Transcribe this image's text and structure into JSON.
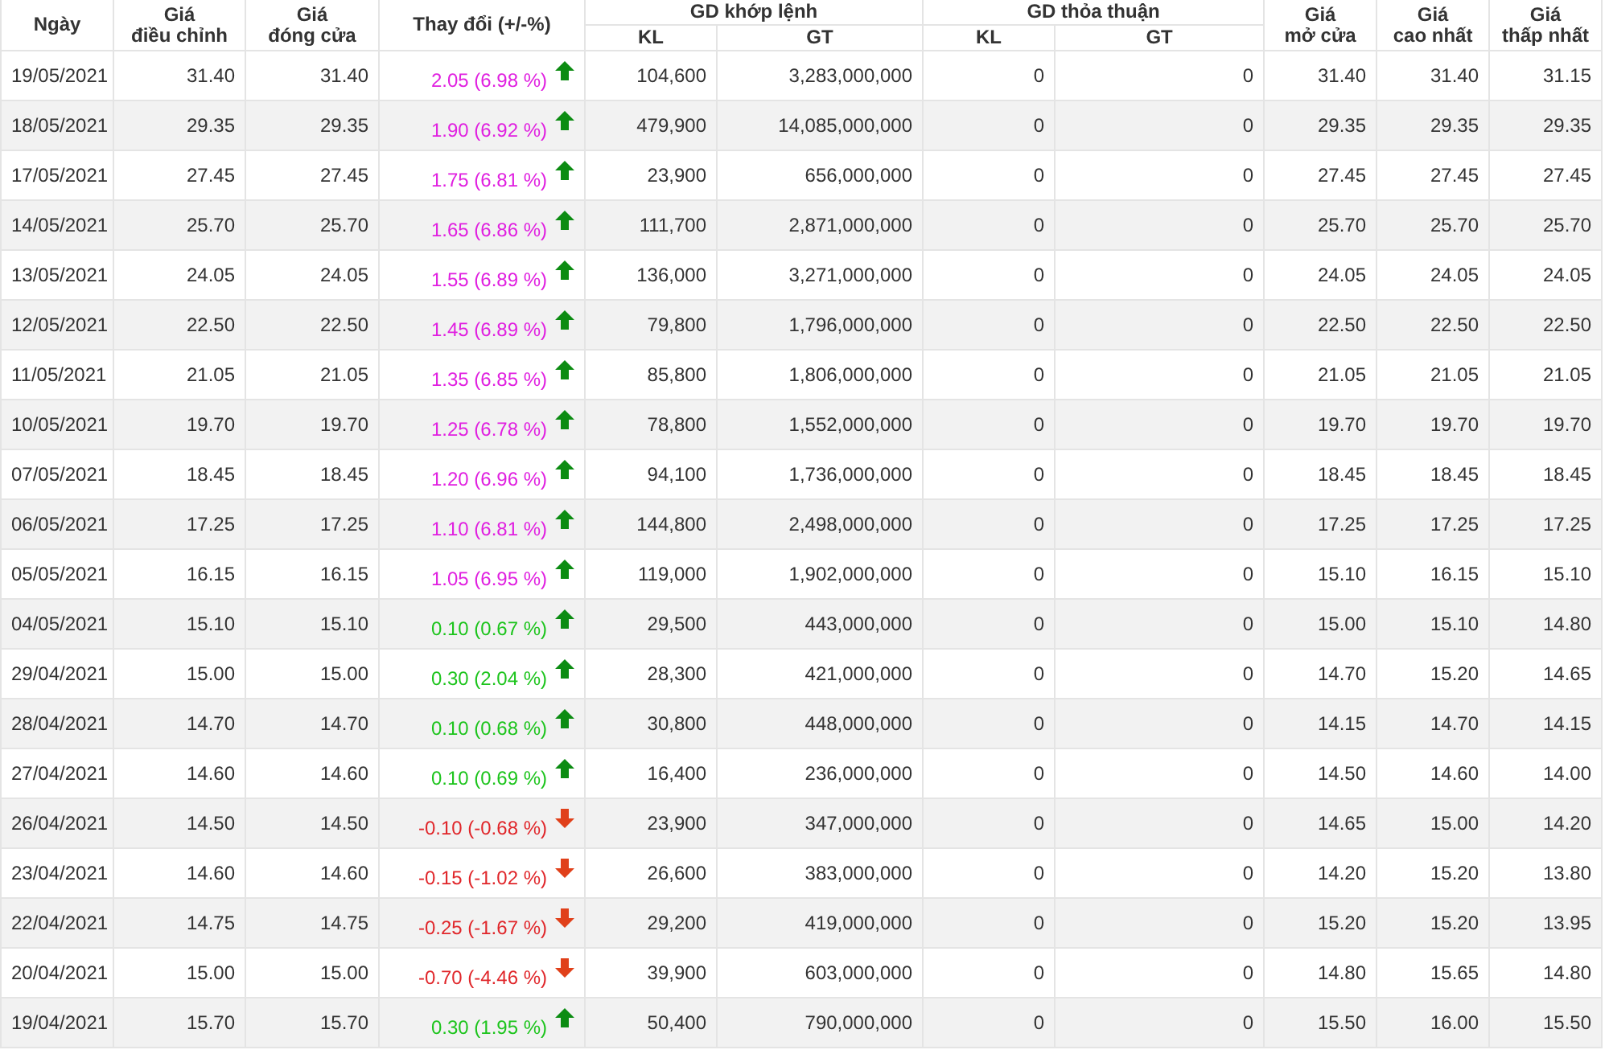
{
  "table": {
    "columns": [
      {
        "label": "Ngày"
      },
      {
        "label": "Giá\nđiều chỉnh"
      },
      {
        "label": "Giá\nđóng cửa"
      },
      {
        "label": "Thay đổi (+/-%)"
      },
      {
        "label": "GD khớp lệnh",
        "children": [
          "KL",
          "GT"
        ]
      },
      {
        "label": "GD thỏa thuận",
        "children": [
          "KL",
          "GT"
        ]
      },
      {
        "label": "Giá\nmở cửa"
      },
      {
        "label": "Giá\ncao nhất"
      },
      {
        "label": "Giá\nthấp nhất"
      }
    ],
    "rows": [
      {
        "date": "19/05/2021",
        "adjusted": "31.40",
        "close": "31.40",
        "change": "2.05 (6.98 %)",
        "kind": "ceiling",
        "matched_kl": "104,600",
        "matched_gt": "3,283,000,000",
        "deal_kl": "0",
        "deal_gt": "0",
        "open": "31.40",
        "high": "31.40",
        "low": "31.15"
      },
      {
        "date": "18/05/2021",
        "adjusted": "29.35",
        "close": "29.35",
        "change": "1.90 (6.92 %)",
        "kind": "ceiling",
        "matched_kl": "479,900",
        "matched_gt": "14,085,000,000",
        "deal_kl": "0",
        "deal_gt": "0",
        "open": "29.35",
        "high": "29.35",
        "low": "29.35"
      },
      {
        "date": "17/05/2021",
        "adjusted": "27.45",
        "close": "27.45",
        "change": "1.75 (6.81 %)",
        "kind": "ceiling",
        "matched_kl": "23,900",
        "matched_gt": "656,000,000",
        "deal_kl": "0",
        "deal_gt": "0",
        "open": "27.45",
        "high": "27.45",
        "low": "27.45"
      },
      {
        "date": "14/05/2021",
        "adjusted": "25.70",
        "close": "25.70",
        "change": "1.65 (6.86 %)",
        "kind": "ceiling",
        "matched_kl": "111,700",
        "matched_gt": "2,871,000,000",
        "deal_kl": "0",
        "deal_gt": "0",
        "open": "25.70",
        "high": "25.70",
        "low": "25.70"
      },
      {
        "date": "13/05/2021",
        "adjusted": "24.05",
        "close": "24.05",
        "change": "1.55 (6.89 %)",
        "kind": "ceiling",
        "matched_kl": "136,000",
        "matched_gt": "3,271,000,000",
        "deal_kl": "0",
        "deal_gt": "0",
        "open": "24.05",
        "high": "24.05",
        "low": "24.05"
      },
      {
        "date": "12/05/2021",
        "adjusted": "22.50",
        "close": "22.50",
        "change": "1.45 (6.89 %)",
        "kind": "ceiling",
        "matched_kl": "79,800",
        "matched_gt": "1,796,000,000",
        "deal_kl": "0",
        "deal_gt": "0",
        "open": "22.50",
        "high": "22.50",
        "low": "22.50"
      },
      {
        "date": "11/05/2021",
        "adjusted": "21.05",
        "close": "21.05",
        "change": "1.35 (6.85 %)",
        "kind": "ceiling",
        "matched_kl": "85,800",
        "matched_gt": "1,806,000,000",
        "deal_kl": "0",
        "deal_gt": "0",
        "open": "21.05",
        "high": "21.05",
        "low": "21.05"
      },
      {
        "date": "10/05/2021",
        "adjusted": "19.70",
        "close": "19.70",
        "change": "1.25 (6.78 %)",
        "kind": "ceiling",
        "matched_kl": "78,800",
        "matched_gt": "1,552,000,000",
        "deal_kl": "0",
        "deal_gt": "0",
        "open": "19.70",
        "high": "19.70",
        "low": "19.70"
      },
      {
        "date": "07/05/2021",
        "adjusted": "18.45",
        "close": "18.45",
        "change": "1.20 (6.96 %)",
        "kind": "ceiling",
        "matched_kl": "94,100",
        "matched_gt": "1,736,000,000",
        "deal_kl": "0",
        "deal_gt": "0",
        "open": "18.45",
        "high": "18.45",
        "low": "18.45"
      },
      {
        "date": "06/05/2021",
        "adjusted": "17.25",
        "close": "17.25",
        "change": "1.10 (6.81 %)",
        "kind": "ceiling",
        "matched_kl": "144,800",
        "matched_gt": "2,498,000,000",
        "deal_kl": "0",
        "deal_gt": "0",
        "open": "17.25",
        "high": "17.25",
        "low": "17.25"
      },
      {
        "date": "05/05/2021",
        "adjusted": "16.15",
        "close": "16.15",
        "change": "1.05 (6.95 %)",
        "kind": "ceiling",
        "matched_kl": "119,000",
        "matched_gt": "1,902,000,000",
        "deal_kl": "0",
        "deal_gt": "0",
        "open": "15.10",
        "high": "16.15",
        "low": "15.10"
      },
      {
        "date": "04/05/2021",
        "adjusted": "15.10",
        "close": "15.10",
        "change": "0.10 (0.67 %)",
        "kind": "up",
        "matched_kl": "29,500",
        "matched_gt": "443,000,000",
        "deal_kl": "0",
        "deal_gt": "0",
        "open": "15.00",
        "high": "15.10",
        "low": "14.80"
      },
      {
        "date": "29/04/2021",
        "adjusted": "15.00",
        "close": "15.00",
        "change": "0.30 (2.04 %)",
        "kind": "up",
        "matched_kl": "28,300",
        "matched_gt": "421,000,000",
        "deal_kl": "0",
        "deal_gt": "0",
        "open": "14.70",
        "high": "15.20",
        "low": "14.65"
      },
      {
        "date": "28/04/2021",
        "adjusted": "14.70",
        "close": "14.70",
        "change": "0.10 (0.68 %)",
        "kind": "up",
        "matched_kl": "30,800",
        "matched_gt": "448,000,000",
        "deal_kl": "0",
        "deal_gt": "0",
        "open": "14.15",
        "high": "14.70",
        "low": "14.15"
      },
      {
        "date": "27/04/2021",
        "adjusted": "14.60",
        "close": "14.60",
        "change": "0.10 (0.69 %)",
        "kind": "up",
        "matched_kl": "16,400",
        "matched_gt": "236,000,000",
        "deal_kl": "0",
        "deal_gt": "0",
        "open": "14.50",
        "high": "14.60",
        "low": "14.00"
      },
      {
        "date": "26/04/2021",
        "adjusted": "14.50",
        "close": "14.50",
        "change": "-0.10 (-0.68 %)",
        "kind": "down",
        "matched_kl": "23,900",
        "matched_gt": "347,000,000",
        "deal_kl": "0",
        "deal_gt": "0",
        "open": "14.65",
        "high": "15.00",
        "low": "14.20"
      },
      {
        "date": "23/04/2021",
        "adjusted": "14.60",
        "close": "14.60",
        "change": "-0.15 (-1.02 %)",
        "kind": "down",
        "matched_kl": "26,600",
        "matched_gt": "383,000,000",
        "deal_kl": "0",
        "deal_gt": "0",
        "open": "14.20",
        "high": "15.20",
        "low": "13.80"
      },
      {
        "date": "22/04/2021",
        "adjusted": "14.75",
        "close": "14.75",
        "change": "-0.25 (-1.67 %)",
        "kind": "down",
        "matched_kl": "29,200",
        "matched_gt": "419,000,000",
        "deal_kl": "0",
        "deal_gt": "0",
        "open": "15.20",
        "high": "15.20",
        "low": "13.95"
      },
      {
        "date": "20/04/2021",
        "adjusted": "15.00",
        "close": "15.00",
        "change": "-0.70 (-4.46 %)",
        "kind": "down",
        "matched_kl": "39,900",
        "matched_gt": "603,000,000",
        "deal_kl": "0",
        "deal_gt": "0",
        "open": "14.80",
        "high": "15.65",
        "low": "14.80"
      },
      {
        "date": "19/04/2021",
        "adjusted": "15.70",
        "close": "15.70",
        "change": "0.30 (1.95 %)",
        "kind": "up",
        "matched_kl": "50,400",
        "matched_gt": "790,000,000",
        "deal_kl": "0",
        "deal_gt": "0",
        "open": "15.50",
        "high": "16.00",
        "low": "15.50"
      }
    ]
  }
}
